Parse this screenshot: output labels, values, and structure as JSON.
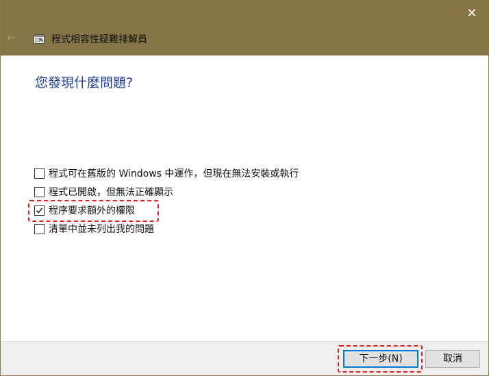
{
  "window": {
    "close_glyph": "✕",
    "back_glyph": "←",
    "title": "程式相容性疑難排解員",
    "icon": "compat-troubleshooter-icon"
  },
  "main": {
    "question": "您發現什麼問題?",
    "options": [
      {
        "label": "程式可在舊版的 Windows 中運作，但現在無法安裝或執行",
        "checked": false
      },
      {
        "label": "程式已開啟，但無法正確顯示",
        "checked": false
      },
      {
        "label": "程序要求額外的權限",
        "checked": true
      },
      {
        "label": "清單中並未列出我的問題",
        "checked": false
      }
    ]
  },
  "footer": {
    "next_label": "下一步(N)",
    "cancel_label": "取消"
  },
  "colors": {
    "titlebar": "#857544",
    "heading": "#1e3d9b",
    "highlight": "#e11a1a",
    "primary_border": "#0078d7"
  }
}
